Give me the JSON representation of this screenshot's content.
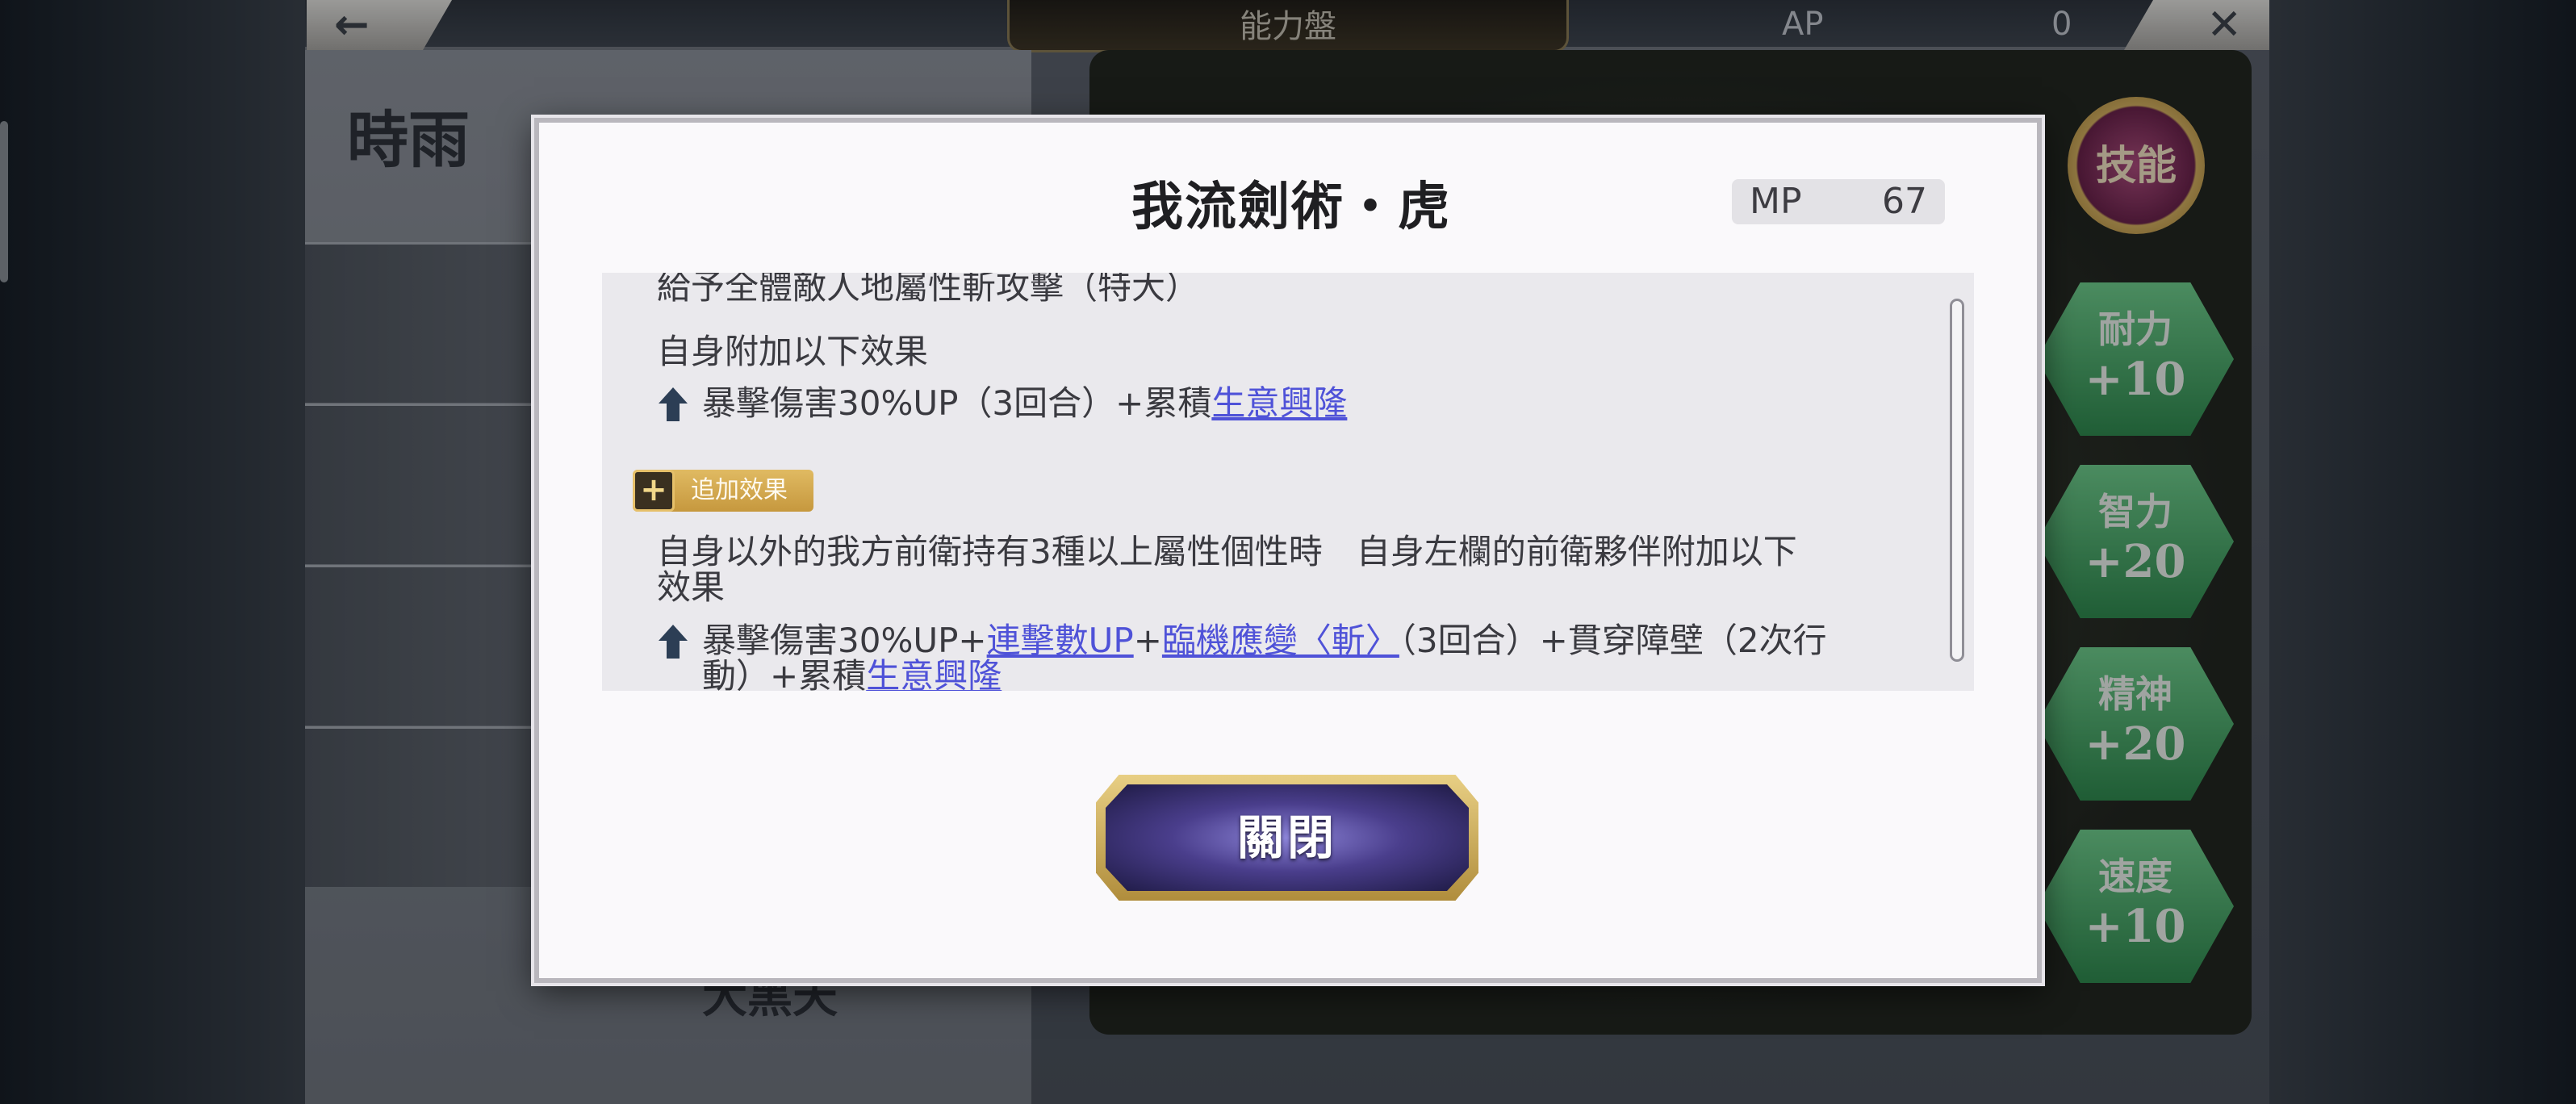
{
  "background": {
    "top_bar": {
      "back_icon": "back-arrow-icon",
      "back_glyph": "←",
      "tab_label": "能力盤",
      "ap_label": "AP",
      "ap_value": "0",
      "close_icon": "close-icon",
      "close_glyph": "✕"
    },
    "character": {
      "name": "時雨",
      "bottom_name": "大黑天"
    },
    "board": {
      "skills_badge": "技能",
      "stats": [
        {
          "name": "耐力",
          "value": "+10"
        },
        {
          "name": "智力",
          "value": "+20"
        },
        {
          "name": "精神",
          "value": "+20"
        },
        {
          "name": "速度",
          "value": "+10"
        }
      ]
    }
  },
  "modal": {
    "title": "我流劍術・虎",
    "mp_label": "MP",
    "mp_value": "67",
    "description": {
      "line1": "給予全體敵人地屬性斬攻擊（特大）",
      "line2": "自身附加以下效果",
      "line3_prefix": "暴擊傷害30%UP（3回合）+累積",
      "line3_link": "生意興隆",
      "extra_badge_label": "追加效果",
      "extra_icon": "plus-icon",
      "line4a": "自身以外的我方前衛持有3種以上屬性個性時　自身左欄的前衛夥伴附加以下",
      "line4b": "效果",
      "line5_prefix": "暴擊傷害30%UP+",
      "line5_link1": "連擊數UP",
      "line5_plus": "+",
      "line5_link2": "臨機應變〈斬〉",
      "line5_suffix": "（3回合）+貫穿障壁（2次行",
      "line6_prefix": "動）+累積",
      "line6_link": "生意興隆",
      "arrow_icon": "up-arrow-icon"
    },
    "close_button": "關閉"
  },
  "colors": {
    "link": "#4f52d8",
    "badge_gold": "#d4aa52",
    "button_purple": "#4a3e8c",
    "stat_green": "#3fa35e"
  }
}
